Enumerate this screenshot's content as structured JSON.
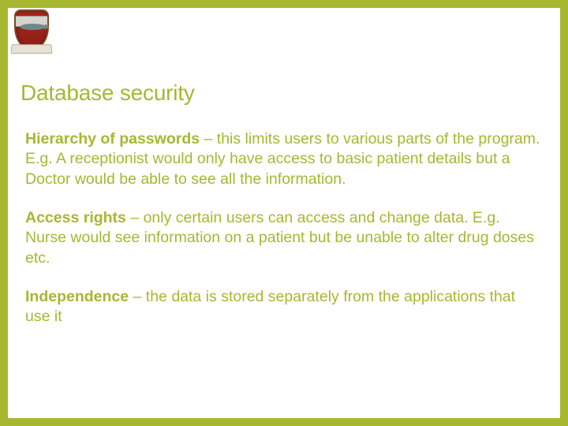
{
  "crest": {
    "ribbon_text": ""
  },
  "title": "Database security",
  "paragraphs": [
    {
      "bold": "Hierarchy of passwords",
      "rest": " – this limits users to various parts of the program. E.g. A receptionist would only have access to basic patient details but a Doctor would be able to see all the information."
    },
    {
      "bold": "Access rights",
      "rest": " – only certain users can access and change data. E.g. Nurse would see information on a patient but be unable to alter drug doses etc."
    },
    {
      "bold": "Independence ",
      "rest": " – the data is stored separately from the applications that use it"
    }
  ]
}
